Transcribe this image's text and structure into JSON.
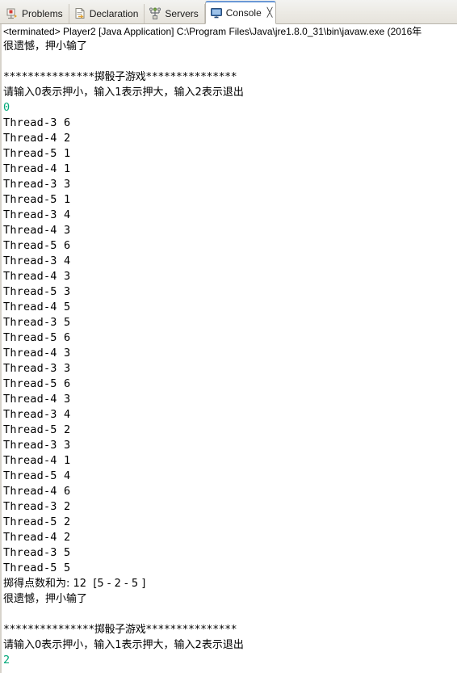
{
  "window": {
    "title": "Console"
  },
  "tabs": [
    {
      "label": "Problems",
      "icon": "problems-icon",
      "active": false,
      "closable": false
    },
    {
      "label": "Declaration",
      "icon": "declaration-icon",
      "active": false,
      "closable": false
    },
    {
      "label": "Servers",
      "icon": "servers-icon",
      "active": false,
      "closable": false
    },
    {
      "label": "Console",
      "icon": "console-icon",
      "active": true,
      "closable": true,
      "close_glyph": "╳"
    }
  ],
  "console": {
    "launch_header": "<terminated> Player2 [Java Application] C:\\Program Files\\Java\\jre1.8.0_31\\bin\\javaw.exe (2016年",
    "lines": [
      {
        "text": "很遗憾，押小输了",
        "style": "cjk",
        "color": "black"
      },
      {
        "text": "",
        "style": "blank",
        "color": "black"
      },
      {
        "text": "***************掷骰子游戏***************",
        "style": "stars",
        "color": "black"
      },
      {
        "text": "请输入0表示押小，输入1表示押大，输入2表示退出",
        "style": "cjk",
        "color": "black"
      },
      {
        "text": "0",
        "style": "mono",
        "color": "green"
      },
      {
        "text": "Thread-3 6",
        "style": "mono",
        "color": "black"
      },
      {
        "text": "Thread-4 2",
        "style": "mono",
        "color": "black"
      },
      {
        "text": "Thread-5 1",
        "style": "mono",
        "color": "black"
      },
      {
        "text": "Thread-4 1",
        "style": "mono",
        "color": "black"
      },
      {
        "text": "Thread-3 3",
        "style": "mono",
        "color": "black"
      },
      {
        "text": "Thread-5 1",
        "style": "mono",
        "color": "black"
      },
      {
        "text": "Thread-3 4",
        "style": "mono",
        "color": "black"
      },
      {
        "text": "Thread-4 3",
        "style": "mono",
        "color": "black"
      },
      {
        "text": "Thread-5 6",
        "style": "mono",
        "color": "black"
      },
      {
        "text": "Thread-3 4",
        "style": "mono",
        "color": "black"
      },
      {
        "text": "Thread-4 3",
        "style": "mono",
        "color": "black"
      },
      {
        "text": "Thread-5 3",
        "style": "mono",
        "color": "black"
      },
      {
        "text": "Thread-4 5",
        "style": "mono",
        "color": "black"
      },
      {
        "text": "Thread-3 5",
        "style": "mono",
        "color": "black"
      },
      {
        "text": "Thread-5 6",
        "style": "mono",
        "color": "black"
      },
      {
        "text": "Thread-4 3",
        "style": "mono",
        "color": "black"
      },
      {
        "text": "Thread-3 3",
        "style": "mono",
        "color": "black"
      },
      {
        "text": "Thread-5 6",
        "style": "mono",
        "color": "black"
      },
      {
        "text": "Thread-4 3",
        "style": "mono",
        "color": "black"
      },
      {
        "text": "Thread-3 4",
        "style": "mono",
        "color": "black"
      },
      {
        "text": "Thread-5 2",
        "style": "mono",
        "color": "black"
      },
      {
        "text": "Thread-3 3",
        "style": "mono",
        "color": "black"
      },
      {
        "text": "Thread-4 1",
        "style": "mono",
        "color": "black"
      },
      {
        "text": "Thread-5 4",
        "style": "mono",
        "color": "black"
      },
      {
        "text": "Thread-4 6",
        "style": "mono",
        "color": "black"
      },
      {
        "text": "Thread-3 2",
        "style": "mono",
        "color": "black"
      },
      {
        "text": "Thread-5 2",
        "style": "mono",
        "color": "black"
      },
      {
        "text": "Thread-4 2",
        "style": "mono",
        "color": "black"
      },
      {
        "text": "Thread-3 5",
        "style": "mono",
        "color": "black"
      },
      {
        "text": "Thread-5 5",
        "style": "mono",
        "color": "black"
      },
      {
        "text": "掷得点数和为: 12  [5 - 2 - 5 ]",
        "style": "cjk",
        "color": "black"
      },
      {
        "text": "很遗憾，押小输了",
        "style": "cjk",
        "color": "black"
      },
      {
        "text": "",
        "style": "blank",
        "color": "black"
      },
      {
        "text": "***************掷骰子游戏***************",
        "style": "stars",
        "color": "black"
      },
      {
        "text": "请输入0表示押小，输入1表示押大，输入2表示退出",
        "style": "cjk",
        "color": "black"
      },
      {
        "text": "2",
        "style": "mono",
        "color": "green"
      }
    ]
  },
  "colors": {
    "input_echo_green": "#00a878",
    "output_black": "#000000",
    "tab_active_bg": "#ffffff",
    "tab_accent_blue": "#6a98d6"
  }
}
